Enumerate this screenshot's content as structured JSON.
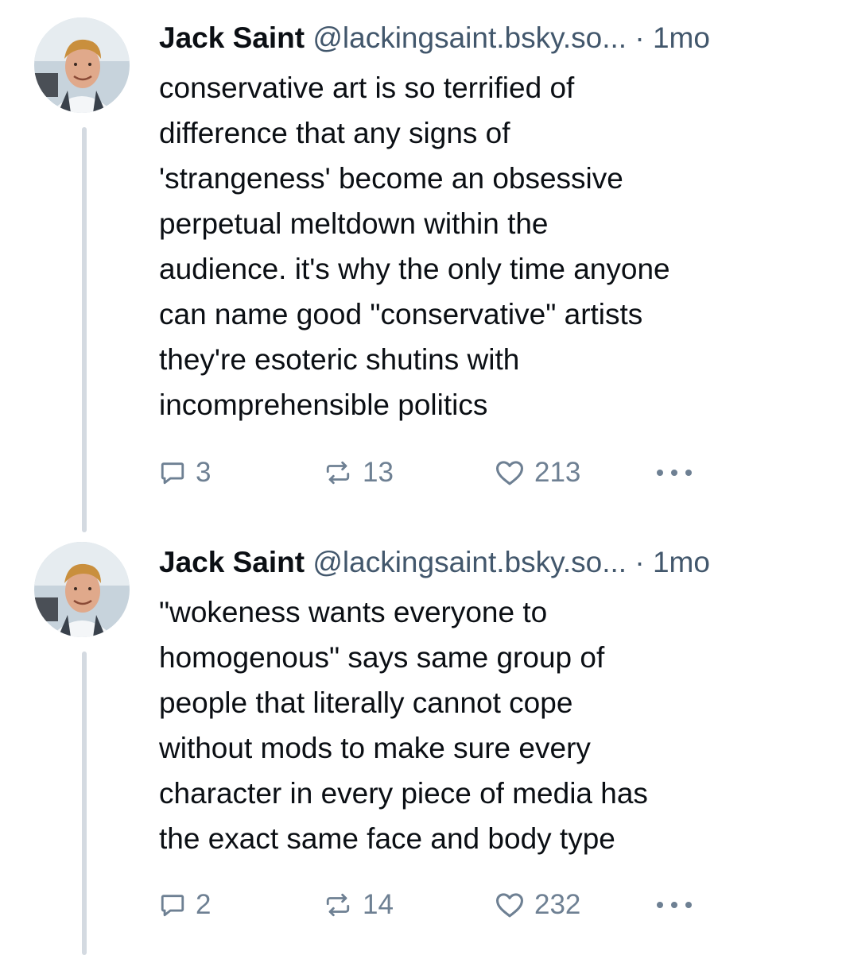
{
  "posts": [
    {
      "author_name": "Jack Saint",
      "handle": "@lackingsaint.bsky.so...",
      "separator": "·",
      "time": "1mo",
      "text": "conservative art is so terrified of\ndifference that any signs of\n'strangeness' become an obsessive\nperpetual meltdown within the\naudience. it's why the only time anyone\ncan name good \"conservative\" artists\nthey're esoteric shutins with\nincomprehensible politics",
      "reply_count": "3",
      "repost_count": "13",
      "like_count": "213"
    },
    {
      "author_name": "Jack Saint",
      "handle": "@lackingsaint.bsky.so...",
      "separator": "·",
      "time": "1mo",
      "text": "\"wokeness wants everyone to\nhomogenous\" says same group of\npeople that literally cannot cope\nwithout mods to make sure every\ncharacter in every piece of media has\nthe exact same face and body type",
      "reply_count": "2",
      "repost_count": "14",
      "like_count": "232"
    }
  ],
  "icons": {
    "reply": "speech-bubble-icon",
    "repost": "repost-arrows-icon",
    "like": "heart-outline-icon",
    "more": "more-dots-icon"
  },
  "colors": {
    "text": "#0b0f14",
    "muted": "#42576c",
    "icon": "#6e8093",
    "thread_line": "#d4dae1",
    "background": "#ffffff"
  }
}
